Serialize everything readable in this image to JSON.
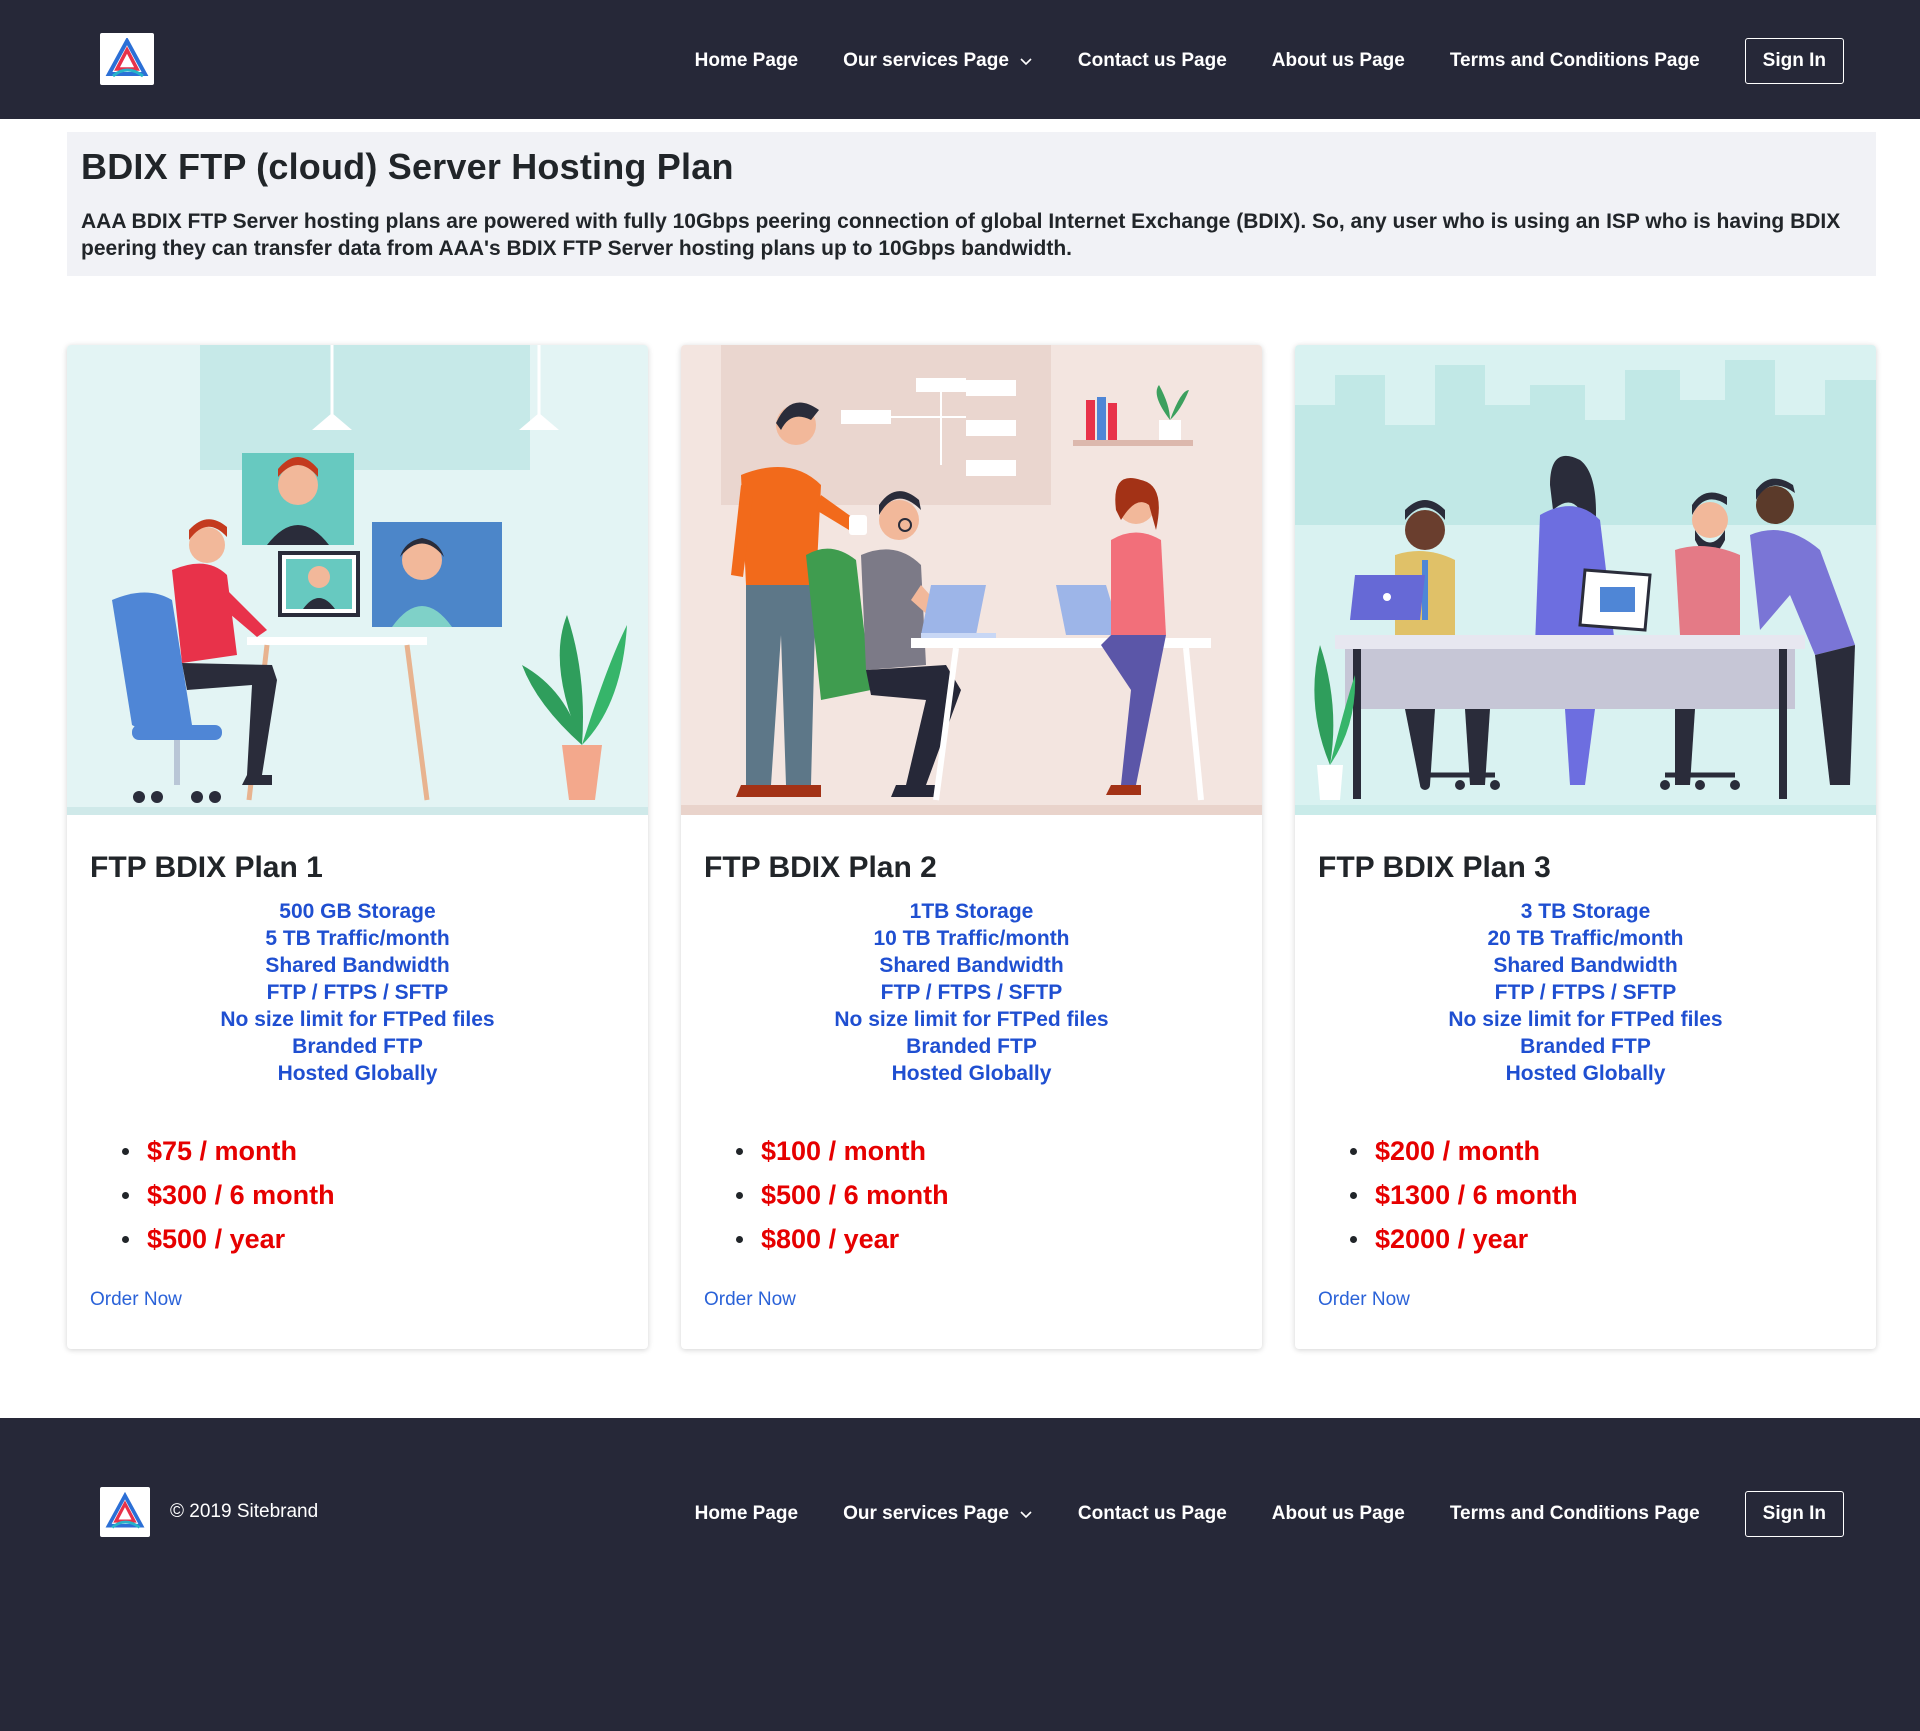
{
  "header": {
    "nav": [
      {
        "label": "Home Page"
      },
      {
        "label": "Our services Page",
        "has_dropdown": true
      },
      {
        "label": "Contact us Page"
      },
      {
        "label": "About us Page"
      },
      {
        "label": "Terms and Conditions Page"
      }
    ],
    "signin_label": "Sign In",
    "logo_icon": "triangle-logo-icon"
  },
  "hero": {
    "title": "BDIX FTP (cloud) Server Hosting Plan",
    "description": "AAA BDIX FTP Server hosting plans are powered with fully 10Gbps peering connection of global Internet Exchange (BDIX). So, any user who is using an ISP who is having BDIX peering they can transfer data from AAA's BDIX FTP Server hosting plans up to 10Gbps bandwidth."
  },
  "plans": [
    {
      "title": "FTP BDIX Plan 1",
      "features": [
        "500 GB Storage",
        "5 TB Traffic/month",
        "Shared Bandwidth",
        "FTP / FTPS / SFTP",
        "No size limit for FTPed files",
        "Branded FTP",
        "Hosted Globally"
      ],
      "prices": [
        "$75 / month",
        "$300 / 6 month",
        "$500 / year"
      ],
      "order_label": "Order Now",
      "image": "video-conference-illustration"
    },
    {
      "title": "FTP BDIX Plan 2",
      "features": [
        "1TB Storage",
        "10 TB Traffic/month",
        "Shared Bandwidth",
        "FTP / FTPS / SFTP",
        "No size limit for FTPed files",
        "Branded FTP",
        "Hosted Globally"
      ],
      "prices": [
        "$100 / month",
        "$500 / 6 month",
        "$800 / year"
      ],
      "order_label": "Order Now",
      "image": "office-teamwork-illustration"
    },
    {
      "title": "FTP BDIX Plan 3",
      "features": [
        "3 TB Storage",
        "20 TB Traffic/month",
        "Shared Bandwidth",
        "FTP / FTPS / SFTP",
        "No size limit for FTPed files",
        "Branded FTP",
        "Hosted Globally"
      ],
      "prices": [
        "$200 / month",
        "$1300 / 6 month",
        "$2000 / year"
      ],
      "order_label": "Order Now",
      "image": "team-meeting-illustration"
    }
  ],
  "footer": {
    "copyright": "© 2019 Sitebrand",
    "nav": [
      {
        "label": "Home Page"
      },
      {
        "label": "Our services Page",
        "has_dropdown": true
      },
      {
        "label": "Contact us Page"
      },
      {
        "label": "About us Page"
      },
      {
        "label": "Terms and Conditions Page"
      }
    ],
    "signin_label": "Sign In"
  },
  "colors": {
    "bar_bg": "#262838",
    "hero_bg": "#f1f2f6",
    "feature_blue": "#1f4fd1",
    "price_red": "#e60000",
    "link_blue": "#2a62d8"
  }
}
